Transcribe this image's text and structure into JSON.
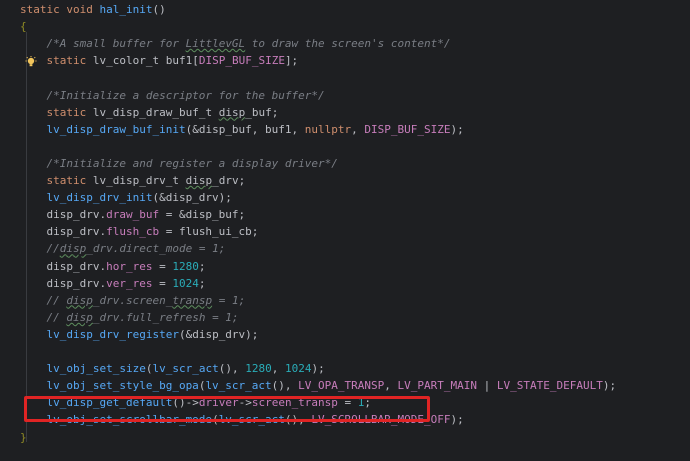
{
  "colors": {
    "background": "#1e1f22",
    "keyword": "#cf8e6d",
    "function": "#56a8f5",
    "type": "#bcbec4",
    "plain": "#bcbec4",
    "variable": "#c77dbb",
    "field": "#c77dbb",
    "macro": "#908b25",
    "number": "#2aacb8",
    "comment": "#7a7e85",
    "constant": "#c77dbb",
    "highlight_box": "#e02424"
  },
  "icons": {
    "gutter": "bulb-icon"
  },
  "code_lines": [
    {
      "tokens": [
        {
          "t": "static void ",
          "c": "keyword"
        },
        {
          "t": "hal_init",
          "c": "function"
        },
        {
          "t": "()",
          "c": "plain"
        }
      ]
    },
    {
      "tokens": [
        {
          "t": "{",
          "c": "macro"
        }
      ]
    },
    {
      "tokens": [
        {
          "t": "    /*A small buffer for ",
          "c": "comment"
        },
        {
          "t": "LittlevGL",
          "c": "comment",
          "u": 1
        },
        {
          "t": " to draw the screen's content*/",
          "c": "comment"
        }
      ]
    },
    {
      "tokens": [
        {
          "t": "    static ",
          "c": "keyword"
        },
        {
          "t": "lv_color_t ",
          "c": "type"
        },
        {
          "t": "buf1",
          "c": "plain"
        },
        {
          "t": "[",
          "c": "plain"
        },
        {
          "t": "DISP_BUF_SIZE",
          "c": "constant"
        },
        {
          "t": "];",
          "c": "plain"
        }
      ]
    },
    {
      "tokens": []
    },
    {
      "tokens": [
        {
          "t": "    /*Initialize a descriptor for the buffer*/",
          "c": "comment"
        }
      ]
    },
    {
      "tokens": [
        {
          "t": "    static ",
          "c": "keyword"
        },
        {
          "t": "lv_disp_draw_buf_t ",
          "c": "type"
        },
        {
          "t": "disp",
          "c": "plain",
          "u": 1
        },
        {
          "t": "_buf;",
          "c": "plain"
        }
      ]
    },
    {
      "tokens": [
        {
          "t": "    lv_disp_draw_buf_init",
          "c": "function"
        },
        {
          "t": "(&disp_buf, buf1, ",
          "c": "plain"
        },
        {
          "t": "nullptr",
          "c": "keyword"
        },
        {
          "t": ", ",
          "c": "plain"
        },
        {
          "t": "DISP_BUF_SIZE",
          "c": "constant"
        },
        {
          "t": ");",
          "c": "plain"
        }
      ]
    },
    {
      "tokens": []
    },
    {
      "tokens": [
        {
          "t": "    /*Initialize and register a display driver*/",
          "c": "comment"
        }
      ]
    },
    {
      "tokens": [
        {
          "t": "    static ",
          "c": "keyword"
        },
        {
          "t": "lv_disp_drv_t ",
          "c": "type"
        },
        {
          "t": "disp",
          "c": "plain",
          "u": 1
        },
        {
          "t": "_drv;",
          "c": "plain"
        }
      ]
    },
    {
      "tokens": [
        {
          "t": "    lv_disp_drv_init",
          "c": "function"
        },
        {
          "t": "(&disp_drv);",
          "c": "plain"
        }
      ]
    },
    {
      "tokens": [
        {
          "t": "    disp_drv.",
          "c": "plain"
        },
        {
          "t": "draw_buf",
          "c": "field"
        },
        {
          "t": " = &disp_buf;",
          "c": "plain"
        }
      ]
    },
    {
      "tokens": [
        {
          "t": "    disp_drv.",
          "c": "plain"
        },
        {
          "t": "flush_cb",
          "c": "field"
        },
        {
          "t": " = flush_ui_cb;",
          "c": "plain"
        }
      ]
    },
    {
      "tokens": [
        {
          "t": "    //",
          "c": "comment"
        },
        {
          "t": "disp",
          "c": "comment",
          "u": 1
        },
        {
          "t": "_drv.direct_mode = 1;",
          "c": "comment"
        }
      ]
    },
    {
      "tokens": [
        {
          "t": "    disp_drv.",
          "c": "plain"
        },
        {
          "t": "hor_res",
          "c": "field"
        },
        {
          "t": " = ",
          "c": "plain"
        },
        {
          "t": "1280",
          "c": "number"
        },
        {
          "t": ";",
          "c": "plain"
        }
      ]
    },
    {
      "tokens": [
        {
          "t": "    disp_drv.",
          "c": "plain"
        },
        {
          "t": "ver_res",
          "c": "field"
        },
        {
          "t": " = ",
          "c": "plain"
        },
        {
          "t": "1024",
          "c": "number"
        },
        {
          "t": ";",
          "c": "plain"
        }
      ]
    },
    {
      "tokens": [
        {
          "t": "    // ",
          "c": "comment"
        },
        {
          "t": "disp",
          "c": "comment",
          "u": 1
        },
        {
          "t": "_drv.screen_",
          "c": "comment"
        },
        {
          "t": "transp",
          "c": "comment",
          "u": 1
        },
        {
          "t": " = 1;",
          "c": "comment"
        }
      ]
    },
    {
      "tokens": [
        {
          "t": "    // ",
          "c": "comment"
        },
        {
          "t": "disp",
          "c": "comment",
          "u": 1
        },
        {
          "t": "_drv.full_refresh = 1;",
          "c": "comment"
        }
      ]
    },
    {
      "tokens": [
        {
          "t": "    lv_disp_drv_register",
          "c": "function"
        },
        {
          "t": "(&disp_drv);",
          "c": "plain"
        }
      ]
    },
    {
      "tokens": []
    },
    {
      "tokens": [
        {
          "t": "    lv_obj_set_size",
          "c": "function"
        },
        {
          "t": "(",
          "c": "plain"
        },
        {
          "t": "lv_scr_act",
          "c": "function"
        },
        {
          "t": "(), ",
          "c": "plain"
        },
        {
          "t": "1280",
          "c": "number"
        },
        {
          "t": ", ",
          "c": "plain"
        },
        {
          "t": "1024",
          "c": "number"
        },
        {
          "t": ");",
          "c": "plain"
        }
      ]
    },
    {
      "tokens": [
        {
          "t": "    lv_obj_set_style_bg_opa",
          "c": "function"
        },
        {
          "t": "(",
          "c": "plain"
        },
        {
          "t": "lv_scr_act",
          "c": "function"
        },
        {
          "t": "(), ",
          "c": "plain"
        },
        {
          "t": "LV_OPA_TRANSP",
          "c": "constant"
        },
        {
          "t": ", ",
          "c": "plain"
        },
        {
          "t": "LV_PART_MAIN",
          "c": "constant"
        },
        {
          "t": " | ",
          "c": "plain"
        },
        {
          "t": "LV_STATE_DEFAULT",
          "c": "constant"
        },
        {
          "t": ");",
          "c": "plain"
        }
      ]
    },
    {
      "tokens": [
        {
          "t": "    lv_disp_get_default",
          "c": "function"
        },
        {
          "t": "()->",
          "c": "plain"
        },
        {
          "t": "driver",
          "c": "field"
        },
        {
          "t": "->",
          "c": "plain"
        },
        {
          "t": "screen_transp",
          "c": "field"
        },
        {
          "t": " = ",
          "c": "plain"
        },
        {
          "t": "1",
          "c": "number"
        },
        {
          "t": ";",
          "c": "plain"
        }
      ]
    },
    {
      "tokens": [
        {
          "t": "    lv_obj_set_scrollbar_mode",
          "c": "function"
        },
        {
          "t": "(",
          "c": "plain"
        },
        {
          "t": "lv_scr_act",
          "c": "function"
        },
        {
          "t": "(), ",
          "c": "plain"
        },
        {
          "t": "LV_SCROLLBAR_MODE_OFF",
          "c": "constant"
        },
        {
          "t": ");",
          "c": "plain"
        }
      ]
    },
    {
      "tokens": [
        {
          "t": "}",
          "c": "macro"
        }
      ]
    }
  ]
}
